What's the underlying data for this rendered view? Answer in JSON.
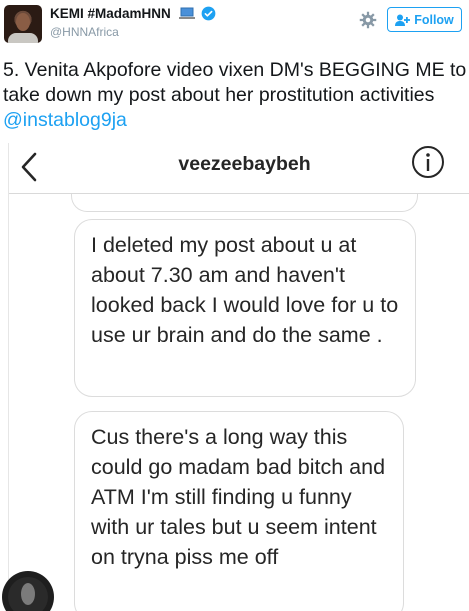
{
  "tweet": {
    "author_name": "KEMI #MadamHNN",
    "handle": "@HNNAfrica",
    "follow_label": "Follow",
    "text_main": "5. Venita Akpofore video vixen DM's BEGGING ME to take down my post about her prostitution activities ",
    "mention": "@instablog9ja",
    "icons": [
      "laptop-icon",
      "verified-icon",
      "gear-icon",
      "add-user-icon"
    ],
    "colors": {
      "accent": "#1da1f2",
      "muted": "#8899a6"
    }
  },
  "dm": {
    "title": "veezeebaybeh",
    "icons": [
      "chevron-left-icon",
      "info-icon"
    ],
    "messages": [
      "I deleted my post about u at about 7.30 am and haven't looked back I would love for u to use ur brain and do the same .",
      "Cus there's a long way this could go madam bad bitch and ATM I'm still finding u funny with ur tales but u seem intent on tryna piss me off"
    ]
  }
}
